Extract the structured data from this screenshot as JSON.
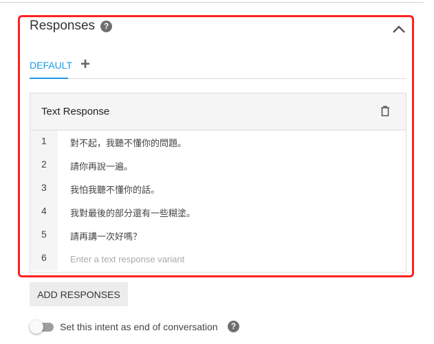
{
  "section": {
    "title": "Responses"
  },
  "tabs": [
    {
      "label": "DEFAULT",
      "active": true
    }
  ],
  "card": {
    "title": "Text Response",
    "rows": [
      {
        "num": "1",
        "text": "對不起，我聽不懂你的問題。"
      },
      {
        "num": "2",
        "text": "請你再說一遍。"
      },
      {
        "num": "3",
        "text": "我怕我聽不懂你的話。"
      },
      {
        "num": "4",
        "text": "我對最後的部分還有一些糊塗。"
      },
      {
        "num": "5",
        "text": "請再講一次好嗎？"
      }
    ],
    "new_row": {
      "num": "6",
      "placeholder": "Enter a text response variant"
    }
  },
  "add_button": "ADD RESPONSES",
  "end_toggle": {
    "label": "Set this intent as end of conversation",
    "on": false
  },
  "colors": {
    "accent": "#1a9be6",
    "highlight": "#ff2020"
  }
}
